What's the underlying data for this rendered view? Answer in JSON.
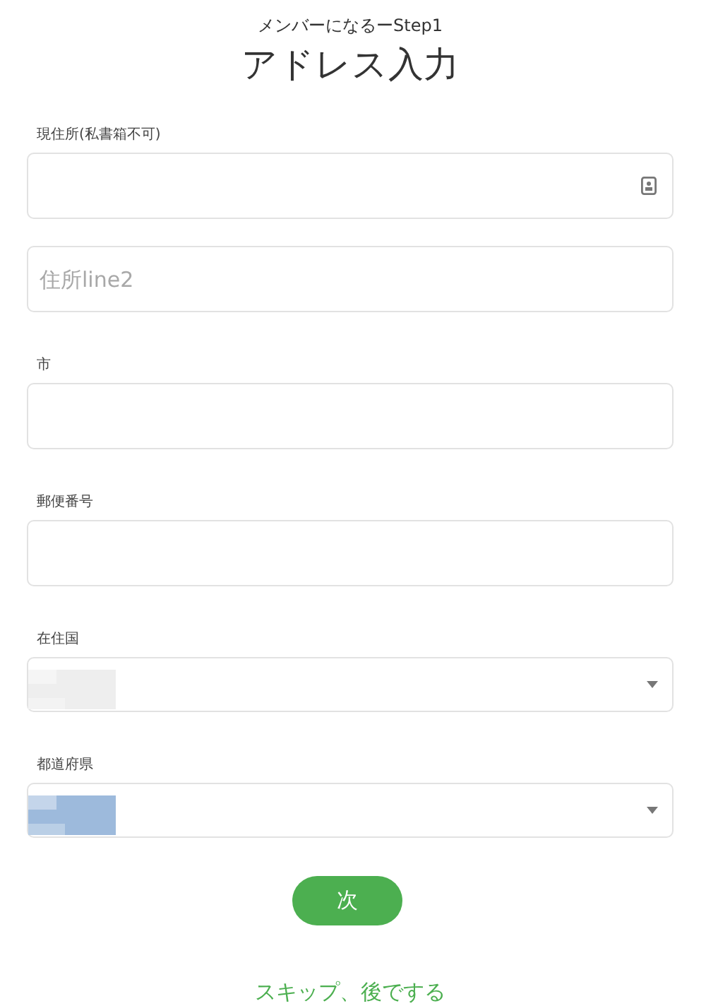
{
  "header": {
    "step": "メンバーになるーStep1",
    "title": "アドレス入力"
  },
  "fields": [
    {
      "kind": "text",
      "label": "現住所(私書箱不可)",
      "autofill_icon": true
    },
    {
      "kind": "text",
      "placeholder": "住所line2"
    },
    {
      "kind": "text",
      "label": "市"
    },
    {
      "kind": "text",
      "label": "郵便番号"
    },
    {
      "kind": "select",
      "label": "在住国",
      "color": "#eeeeee"
    },
    {
      "kind": "select",
      "label": "都道府県",
      "color": "#9dbadc"
    }
  ],
  "next_button": "次",
  "skip_link": "スキップ、後でする"
}
